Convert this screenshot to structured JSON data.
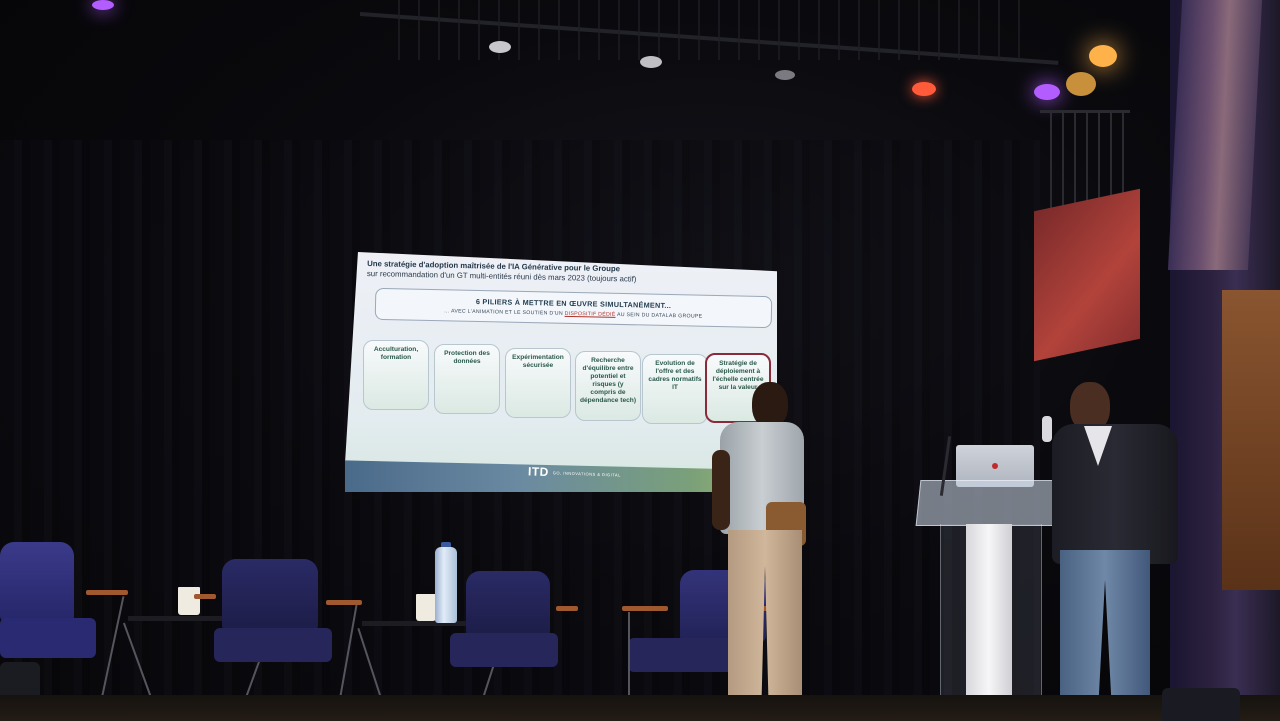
{
  "scene": {
    "type": "photo",
    "colors": {
      "background": "#07070a",
      "stage_light_purple": "#b35cff",
      "stage_light_warm": "#ffb14a",
      "accent_red": "#b0332b"
    }
  },
  "slide": {
    "title_line1": "Une stratégie d'adoption maîtrisée de l'IA Générative pour le Groupe",
    "title_line2": "sur recommandation d'un GT multi-entités réuni dès mars 2023 (toujours actif)",
    "pillars_heading": "6 PILIERS À METTRE EN ŒUVRE SIMULTANÉMENT...",
    "pillars_sub_before": "... AVEC L'ANIMATION ET LE SOUTIEN D'UN",
    "pillars_sub_link": "DISPOSITIF DÉDIÉ",
    "pillars_sub_after": "AU SEIN DU DATALAB GROUPE",
    "pillars": [
      {
        "label": "Acculturation, formation"
      },
      {
        "label": "Protection des données"
      },
      {
        "label": "Expérimentation sécurisée"
      },
      {
        "label": "Recherche d'équilibre entre potentiel et risques (y compris de dépendance tech)"
      },
      {
        "label": "Evolution de l'offre et des cadres normatifs IT"
      },
      {
        "label": "Stratégie de déploiement à l'échelle centrée sur la valeur"
      }
    ],
    "logo_text": "ITD",
    "logo_tagline": "GO, INNOVATIONS & DIGITAL"
  }
}
